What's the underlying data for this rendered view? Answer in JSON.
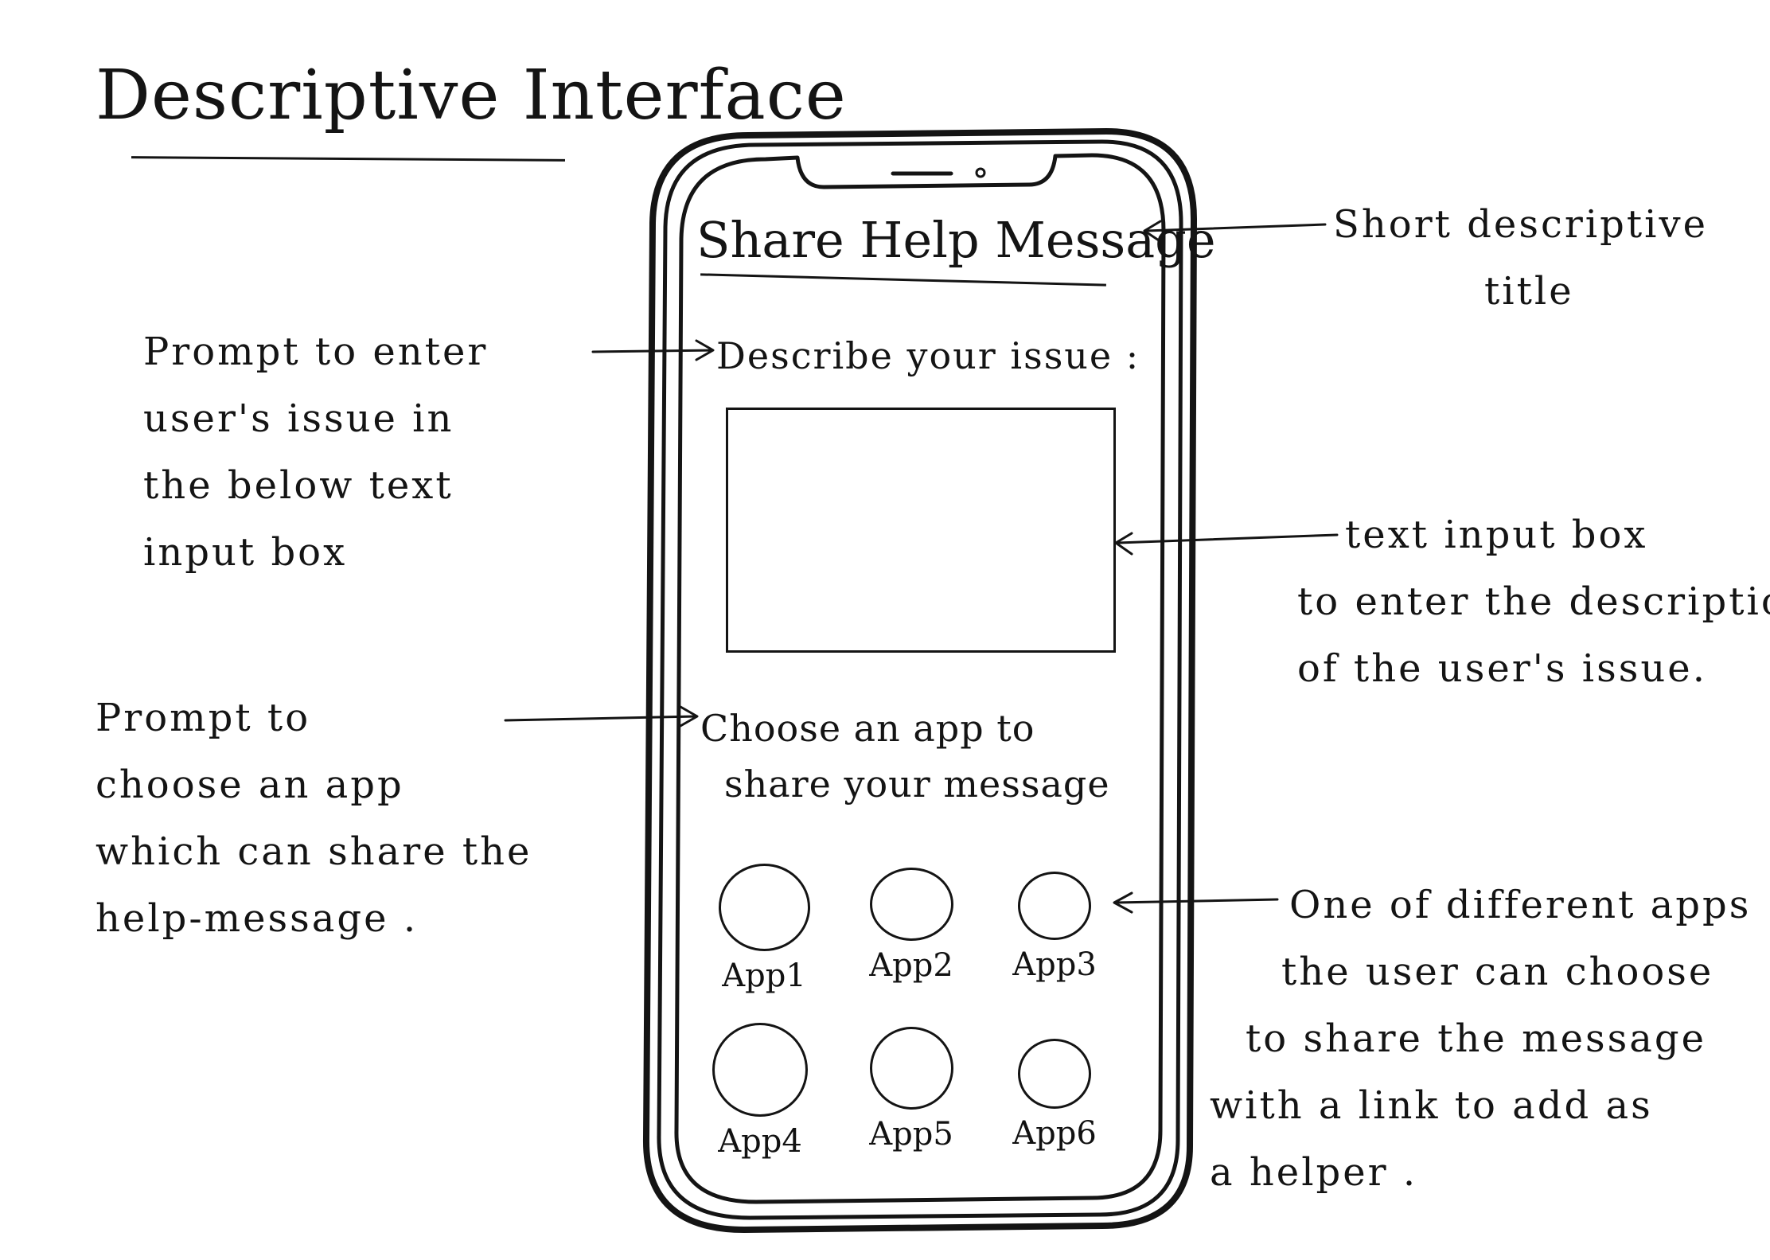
{
  "header": {
    "page_title": "Descriptive Interface"
  },
  "phone_screen": {
    "title": "Share Help Message",
    "issue_prompt": "Describe your issue :",
    "issue_box_value": "",
    "app_prompt_line1": "Choose an app to",
    "app_prompt_line2": "share your message",
    "apps": [
      {
        "label": "App1"
      },
      {
        "label": "App2"
      },
      {
        "label": "App3"
      },
      {
        "label": "App4"
      },
      {
        "label": "App5"
      },
      {
        "label": "App6"
      }
    ]
  },
  "annotations": {
    "title_note": [
      "Short descriptive",
      "title"
    ],
    "issue_prompt_note": [
      "Prompt to enter",
      "user's issue in",
      "the below text",
      "input box"
    ],
    "text_box_note": [
      "text input box",
      "to enter the description",
      "of the user's issue."
    ],
    "app_prompt_note": [
      "Prompt to",
      "choose an app",
      "which can share the",
      "help-message ."
    ],
    "apps_note": [
      "One of different apps",
      "the user can choose",
      "to share the message",
      "with a link to add as",
      "a helper ."
    ]
  },
  "colors": {
    "ink": "#141414",
    "paper": "#ffffff"
  }
}
